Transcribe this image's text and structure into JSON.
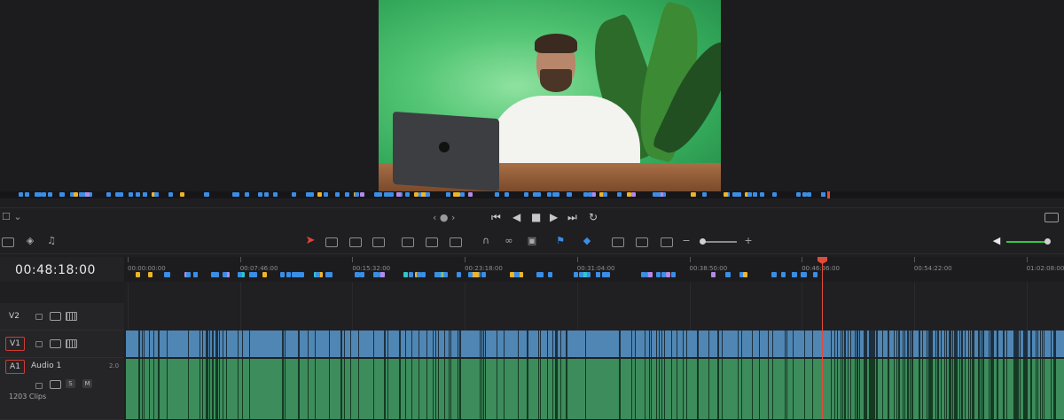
{
  "viewer": {
    "zoom_label": "☐ ⌄"
  },
  "transport": {
    "jog": "‹ ● ›",
    "buttons": [
      "⏮",
      "◀",
      "■",
      "▶",
      "⏭",
      "↻"
    ]
  },
  "toolbar": {
    "zoom_minus": "−",
    "zoom_plus": "+"
  },
  "timeline": {
    "timecode": "00:48:18:00",
    "ruler_labels": [
      "00:00:00:00",
      "00:07:46:00",
      "00:15:32:00",
      "00:23:18:00",
      "00:31:04:00",
      "00:38:50:00",
      "00:46:36:00",
      "00:54:22:00",
      "01:02:08:00"
    ],
    "tracks": {
      "v2": {
        "id": "V2"
      },
      "v1": {
        "id": "V1"
      },
      "a1": {
        "id": "A1",
        "name": "Audio 1",
        "channels": "2.0",
        "solo": "S",
        "mute": "M",
        "clips": "1203 Clips"
      }
    }
  },
  "colors": {
    "accent": "#e24b3a",
    "video_clip": "#4f86b4",
    "audio_clip": "#3d8c5c",
    "volume": "#2ecc40"
  },
  "markers_colors": [
    "#3a8ee6",
    "#f0b429",
    "#b48ae6",
    "#2fc7c7",
    "#d38ce0",
    "#ffffff"
  ]
}
